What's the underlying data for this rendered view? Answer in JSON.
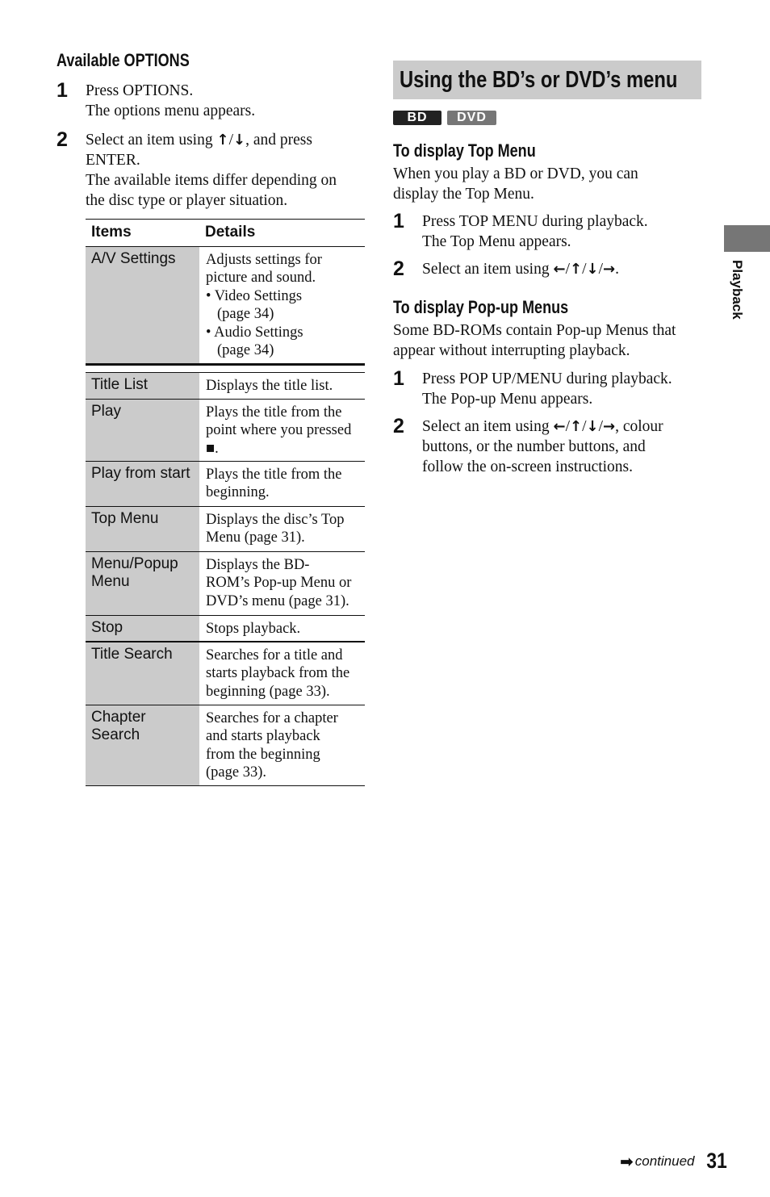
{
  "left": {
    "heading": "Available OPTIONS",
    "steps": [
      {
        "num": "1",
        "lines": [
          "Press OPTIONS.",
          "The options menu appears."
        ]
      },
      {
        "num": "2",
        "line1_pre": "Select an item using ",
        "line1_post": ", and press",
        "lines": [
          "ENTER.",
          "The available items differ depending on",
          "the disc type or player situation."
        ]
      }
    ],
    "icons": {
      "up": "↑",
      "down": "↓",
      "slash": "/",
      "left": "←",
      "right": "→",
      "stop": "■"
    },
    "table": {
      "headers": [
        "Items",
        "Details"
      ],
      "rows": [
        {
          "item": [
            "A/V Settings"
          ],
          "details": [
            "Adjusts settings for",
            "picture and sound.",
            "• Video Settings",
            "(page 34)",
            "• Audio Settings",
            "(page 34)"
          ]
        },
        {
          "item": [
            "Title List"
          ],
          "details": [
            "Displays the title list."
          ]
        },
        {
          "item": [
            "Play"
          ],
          "details": [
            "Plays the title from the",
            "point where you pressed",
            "■."
          ]
        },
        {
          "item": [
            "Play from start"
          ],
          "details": [
            "Plays the title from the",
            "beginning."
          ]
        },
        {
          "item": [
            "Top Menu"
          ],
          "details": [
            "Displays the disc’s Top",
            "Menu (page 31)."
          ]
        },
        {
          "item": [
            "Menu/Popup",
            "Menu"
          ],
          "details": [
            "Displays the BD-",
            "ROM’s Pop-up Menu or",
            "DVD’s menu (page 31)."
          ]
        },
        {
          "item": [
            "Stop"
          ],
          "details": [
            "Stops playback."
          ]
        },
        {
          "item": [
            "Title Search"
          ],
          "details": [
            "Searches for a title and",
            "starts playback from the",
            "beginning (page 33)."
          ]
        },
        {
          "item": [
            "Chapter",
            "Search"
          ],
          "details": [
            "Searches for a chapter",
            "and starts playback",
            "from the beginning",
            "(page 33)."
          ]
        }
      ]
    }
  },
  "right": {
    "title": "Using the BD’s or DVD’s menu",
    "badges": [
      "BD",
      "DVD"
    ],
    "top_menu": {
      "heading": "To display Top Menu",
      "intro": [
        "When you play a BD or DVD, you can",
        "display the Top Menu."
      ],
      "step1": [
        "Press TOP MENU during playback.",
        "The Top Menu appears."
      ],
      "step2_pre": "Select an item using ",
      "step2_post": "."
    },
    "popup": {
      "heading": "To display Pop-up Menus",
      "intro": [
        "Some BD-ROMs contain Pop-up Menus that",
        "appear without interrupting playback."
      ],
      "step1": [
        "Press POP UP/MENU during playback.",
        "The Pop-up Menu appears."
      ],
      "step2_pre": "Select an item using ",
      "step2_post": ", colour",
      "step2_lines": [
        "buttons, or the number buttons, and",
        "follow the on-screen instructions."
      ]
    }
  },
  "side_tab": {
    "label": "Playback"
  },
  "footer": {
    "continued": "continued",
    "page_number": "31"
  }
}
